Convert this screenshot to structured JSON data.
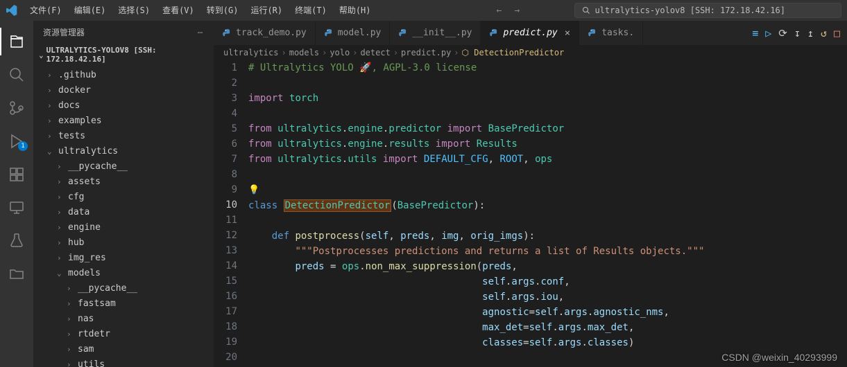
{
  "titlebar": {
    "menus": [
      "文件(F)",
      "编辑(E)",
      "选择(S)",
      "查看(V)",
      "转到(G)",
      "运行(R)",
      "终端(T)",
      "帮助(H)"
    ],
    "search_text": "ultralytics-yolov8 [SSH: 172.18.42.16]"
  },
  "sidebar": {
    "header": "资源管理器",
    "project": "ULTRALYTICS-YOLOV8 [SSH: 172.18.42.16]",
    "tree": [
      {
        "label": ".github",
        "depth": 1,
        "open": false
      },
      {
        "label": "docker",
        "depth": 1,
        "open": false
      },
      {
        "label": "docs",
        "depth": 1,
        "open": false
      },
      {
        "label": "examples",
        "depth": 1,
        "open": false
      },
      {
        "label": "tests",
        "depth": 1,
        "open": false
      },
      {
        "label": "ultralytics",
        "depth": 1,
        "open": true
      },
      {
        "label": "__pycache__",
        "depth": 2,
        "open": false
      },
      {
        "label": "assets",
        "depth": 2,
        "open": false
      },
      {
        "label": "cfg",
        "depth": 2,
        "open": false
      },
      {
        "label": "data",
        "depth": 2,
        "open": false
      },
      {
        "label": "engine",
        "depth": 2,
        "open": false
      },
      {
        "label": "hub",
        "depth": 2,
        "open": false
      },
      {
        "label": "img_res",
        "depth": 2,
        "open": false
      },
      {
        "label": "models",
        "depth": 2,
        "open": true
      },
      {
        "label": "__pycache__",
        "depth": 3,
        "open": false
      },
      {
        "label": "fastsam",
        "depth": 3,
        "open": false
      },
      {
        "label": "nas",
        "depth": 3,
        "open": false
      },
      {
        "label": "rtdetr",
        "depth": 3,
        "open": false
      },
      {
        "label": "sam",
        "depth": 3,
        "open": false
      },
      {
        "label": "utils",
        "depth": 3,
        "open": false
      }
    ]
  },
  "tabs": {
    "items": [
      {
        "label": "track_demo.py",
        "active": false
      },
      {
        "label": "model.py",
        "active": false
      },
      {
        "label": "__init__.py",
        "active": false
      },
      {
        "label": "predict.py",
        "active": true
      },
      {
        "label": "tasks.",
        "active": false
      }
    ]
  },
  "breadcrumb": {
    "parts": [
      "ultralytics",
      "models",
      "yolo",
      "detect",
      "predict.py"
    ],
    "cls_icon": "⬡",
    "cls": "DetectionPredictor"
  },
  "code": {
    "lines": [
      {
        "n": 1,
        "html": "<span class='s-c'># Ultralytics YOLO 🚀, AGPL-3.0 license</span>"
      },
      {
        "n": 2,
        "html": ""
      },
      {
        "n": 3,
        "html": "<span class='s-k2'>import</span> <span class='s-lib'>torch</span>"
      },
      {
        "n": 4,
        "html": ""
      },
      {
        "n": 5,
        "html": "<span class='s-k2'>from</span> <span class='s-lib'>ultralytics</span><span class='s-p'>.</span><span class='s-lib'>engine</span><span class='s-p'>.</span><span class='s-lib'>predictor</span> <span class='s-k2'>import</span> <span class='s-cls'>BasePredictor</span>"
      },
      {
        "n": 6,
        "html": "<span class='s-k2'>from</span> <span class='s-lib'>ultralytics</span><span class='s-p'>.</span><span class='s-lib'>engine</span><span class='s-p'>.</span><span class='s-lib'>results</span> <span class='s-k2'>import</span> <span class='s-cls'>Results</span>"
      },
      {
        "n": 7,
        "html": "<span class='s-k2'>from</span> <span class='s-lib'>ultralytics</span><span class='s-p'>.</span><span class='s-lib'>utils</span> <span class='s-k2'>import</span> <span class='s-cn'>DEFAULT_CFG</span><span class='s-p'>, </span><span class='s-cn'>ROOT</span><span class='s-p'>, </span><span class='s-lib'>ops</span>"
      },
      {
        "n": 8,
        "html": ""
      },
      {
        "n": 9,
        "html": "<span class='bulb'>💡</span>"
      },
      {
        "n": 10,
        "html": "<span class='s-k'>class</span> <span class='s-sel s-cls'>DetectionPredictor</span><span class='s-p'>(</span><span class='s-cls'>BasePredictor</span><span class='s-p'>):</span>",
        "cur": true
      },
      {
        "n": 11,
        "html": ""
      },
      {
        "n": 12,
        "html": "    <span class='s-k'>def</span> <span class='s-fn'>postprocess</span><span class='s-p'>(</span><span class='s-v'>self</span><span class='s-p'>, </span><span class='s-v'>preds</span><span class='s-p'>, </span><span class='s-v'>img</span><span class='s-p'>, </span><span class='s-v'>orig_imgs</span><span class='s-p'>):</span>"
      },
      {
        "n": 13,
        "html": "        <span class='s-str'>\"\"\"Postprocesses predictions and returns a list of Results objects.\"\"\"</span>"
      },
      {
        "n": 14,
        "html": "        <span class='s-v'>preds</span> <span class='s-p'>=</span> <span class='s-lib'>ops</span><span class='s-p'>.</span><span class='s-fn'>non_max_suppression</span><span class='s-p'>(</span><span class='s-v'>preds</span><span class='s-p'>,</span>"
      },
      {
        "n": 15,
        "html": "                                        <span class='s-v'>self</span><span class='s-p'>.</span><span class='s-v'>args</span><span class='s-p'>.</span><span class='s-v'>conf</span><span class='s-p'>,</span>"
      },
      {
        "n": 16,
        "html": "                                        <span class='s-v'>self</span><span class='s-p'>.</span><span class='s-v'>args</span><span class='s-p'>.</span><span class='s-v'>iou</span><span class='s-p'>,</span>"
      },
      {
        "n": 17,
        "html": "                                        <span class='s-v'>agnostic</span><span class='s-p'>=</span><span class='s-v'>self</span><span class='s-p'>.</span><span class='s-v'>args</span><span class='s-p'>.</span><span class='s-v'>agnostic_nms</span><span class='s-p'>,</span>"
      },
      {
        "n": 18,
        "html": "                                        <span class='s-v'>max_det</span><span class='s-p'>=</span><span class='s-v'>self</span><span class='s-p'>.</span><span class='s-v'>args</span><span class='s-p'>.</span><span class='s-v'>max_det</span><span class='s-p'>,</span>"
      },
      {
        "n": 19,
        "html": "                                        <span class='s-v'>classes</span><span class='s-p'>=</span><span class='s-v'>self</span><span class='s-p'>.</span><span class='s-v'>args</span><span class='s-p'>.</span><span class='s-v'>classes</span><span class='s-p'>)</span>"
      },
      {
        "n": 20,
        "html": ""
      }
    ]
  },
  "debug_badge": "1",
  "watermark": "CSDN @weixin_40293999"
}
